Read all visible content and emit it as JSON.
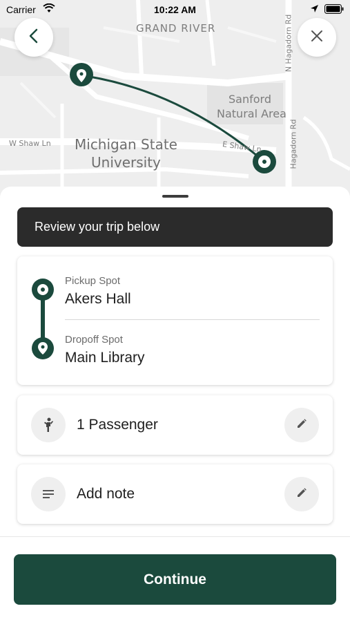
{
  "status_bar": {
    "carrier": "Carrier",
    "time": "10:22 AM"
  },
  "map": {
    "labels": {
      "grand_river": "GRAND RIVER",
      "sanford_1": "Sanford",
      "sanford_2": "Natural Area",
      "msu_1": "Michigan State",
      "msu_2": "University",
      "w_shaw": "W Shaw Ln",
      "e_shaw": "E Shaw Ln",
      "n_hagadorn": "N Hagadorn Rd",
      "hagadorn": "Hagadorn Rd"
    },
    "route_color": "#1b4a3d"
  },
  "header": {
    "back_icon": "chevron-left-icon",
    "close_icon": "close-icon"
  },
  "banner": {
    "text": "Review your trip below"
  },
  "trip": {
    "pickup_label": "Pickup Spot",
    "pickup_value": "Akers Hall",
    "dropoff_label": "Dropoff Spot",
    "dropoff_value": "Main Library"
  },
  "options": {
    "passengers": "1 Passenger",
    "passenger_icon": "person-icon",
    "note": "Add note",
    "note_icon": "notes-icon",
    "edit_icon": "pencil-icon"
  },
  "footer": {
    "continue_label": "Continue"
  },
  "colors": {
    "brand": "#1b4a3d",
    "banner_bg": "#2b2b2b"
  }
}
